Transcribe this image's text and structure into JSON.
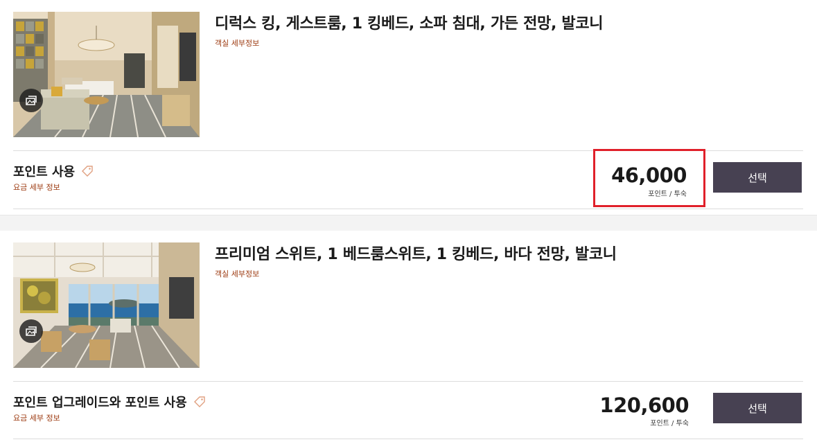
{
  "rooms": [
    {
      "title": "디럭스 킹, 게스트룸, 1 킹베드, 소파 침대, 가든 전망, 발코니",
      "detail_link": "객실 세부정보",
      "icon": "gallery-icon",
      "rate": {
        "name": "포인트 사용",
        "detail_link": "요금 세부 정보",
        "price": "46,000",
        "unit": "포인트 / 투숙",
        "button": "선택",
        "highlighted": true,
        "highlight_color": "#e0202a"
      }
    },
    {
      "title": "프리미엄 스위트, 1 베드룸스위트, 1 킹베드, 바다 전망, 발코니",
      "detail_link": "객실 세부정보",
      "icon": "gallery-icon",
      "rate": {
        "name": "포인트 업그레이드와 포인트 사용",
        "detail_link": "요금 세부 정보",
        "price": "120,600",
        "unit": "포인트 / 투숙",
        "button": "선택",
        "highlighted": false
      }
    }
  ],
  "colors": {
    "accent_link": "#9c3a10",
    "button_bg": "#474152",
    "tag_icon": "#e0a080"
  }
}
